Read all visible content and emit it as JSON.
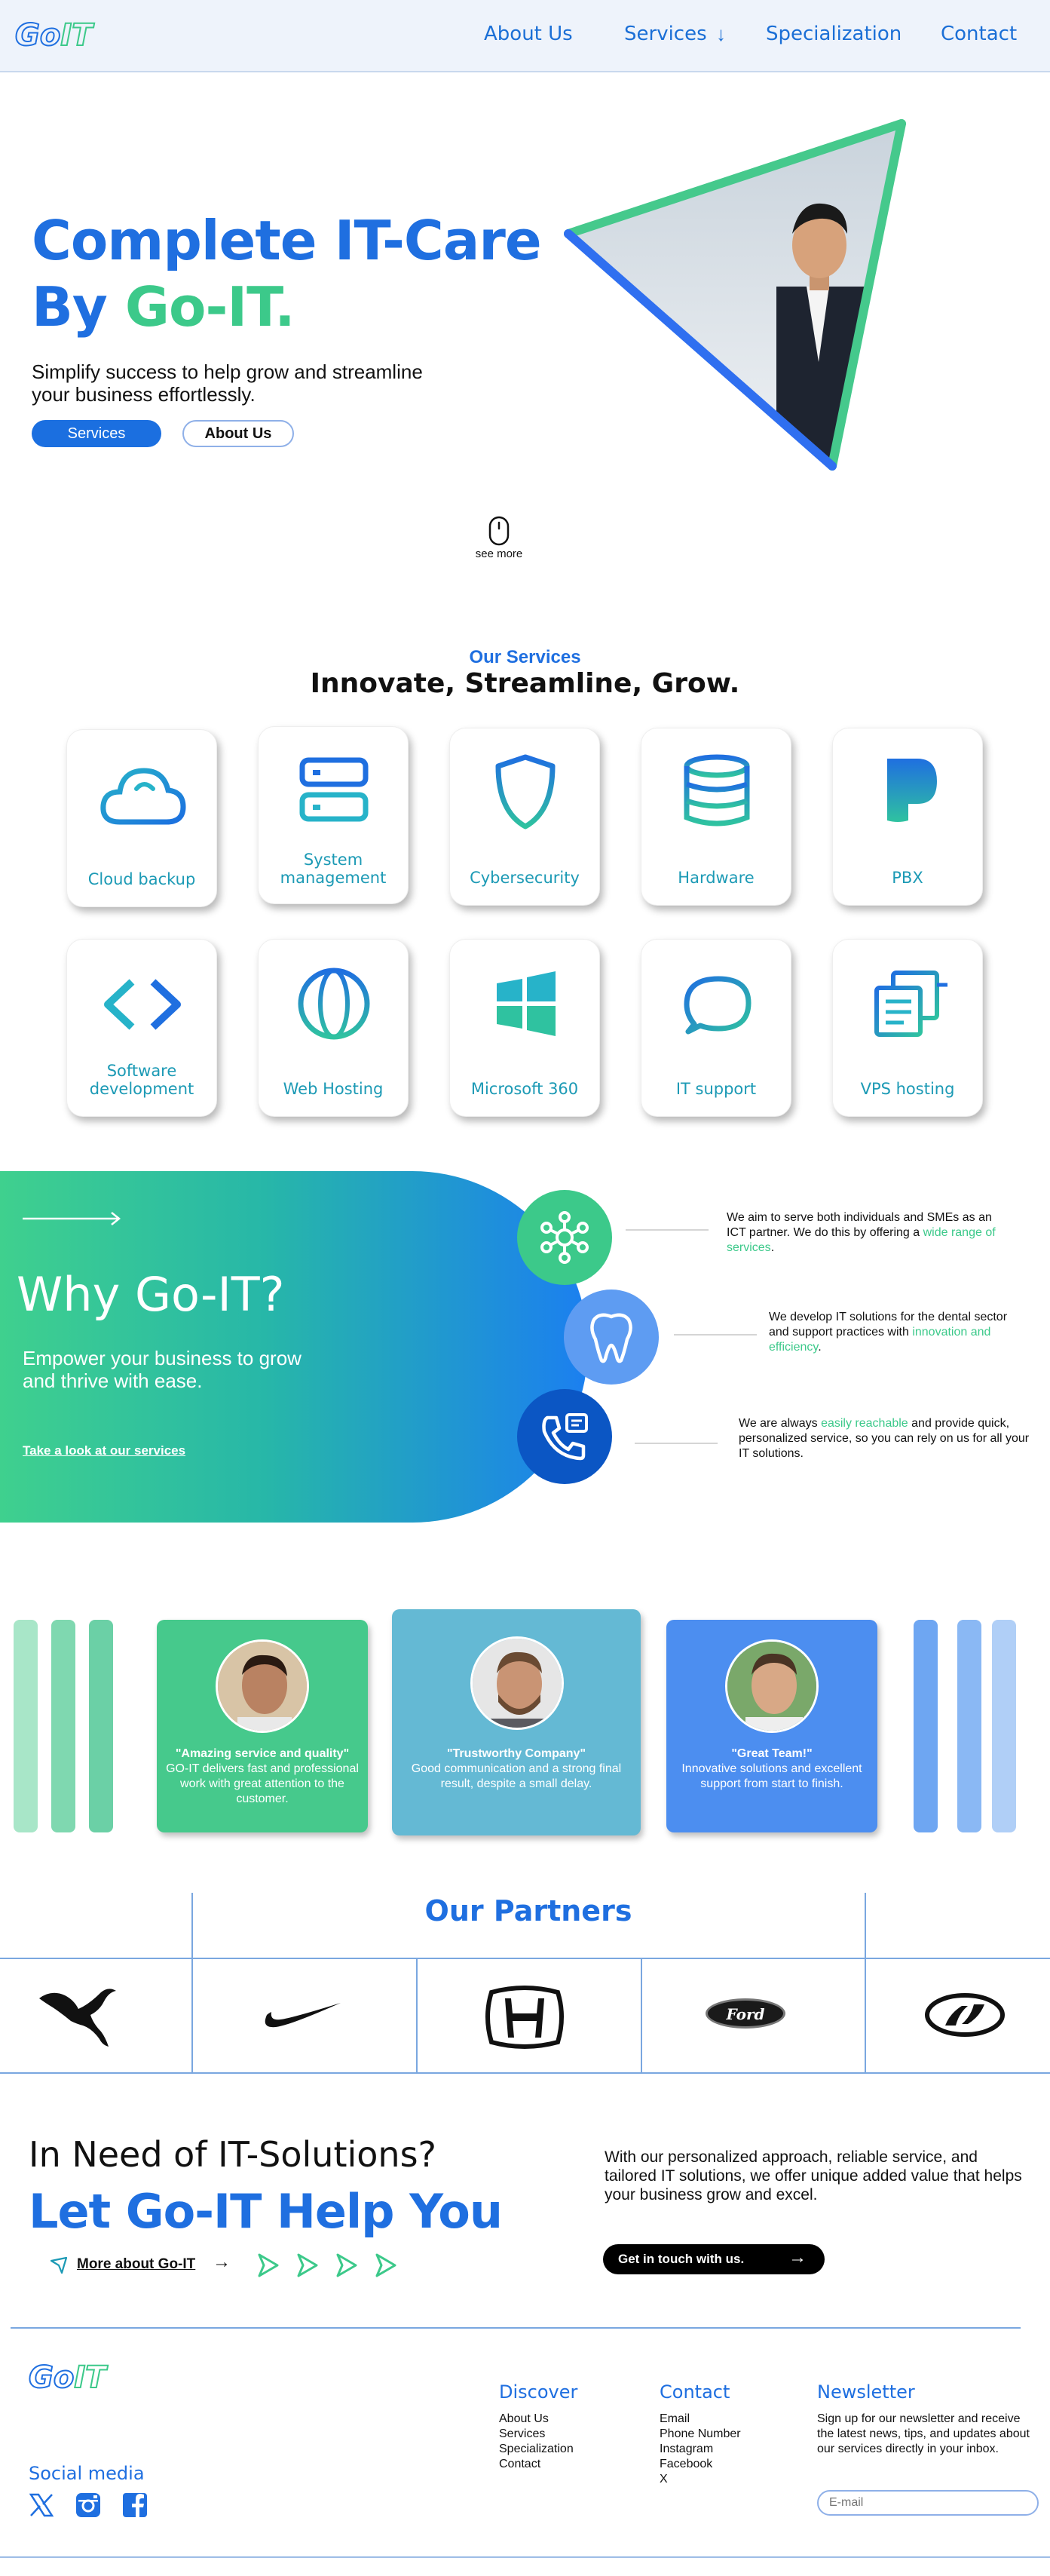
{
  "brand": {
    "logo_go": "Go",
    "logo_it": "IT"
  },
  "nav": {
    "about": "About Us",
    "services": "Services",
    "specialization": "Specialization",
    "contact": "Contact"
  },
  "hero": {
    "title_line1": "Complete IT-Care",
    "title_by": "By ",
    "title_brand": "Go-IT.",
    "subtitle": "Simplify success to help grow and streamline your business effortlessly.",
    "btn_services": "Services",
    "btn_about": "About Us",
    "see_more": "see more"
  },
  "services": {
    "kicker": "Our Services",
    "title": "Innovate, Streamline, Grow.",
    "items": [
      {
        "label": "Cloud backup",
        "icon": "cloud-icon"
      },
      {
        "label": "System management",
        "icon": "server-icon"
      },
      {
        "label": "Cybersecurity",
        "icon": "shield-icon"
      },
      {
        "label": "Hardware",
        "icon": "database-icon"
      },
      {
        "label": "PBX",
        "icon": "pbx-icon"
      },
      {
        "label": "Software development",
        "icon": "code-icon"
      },
      {
        "label": "Web Hosting",
        "icon": "globe-icon"
      },
      {
        "label": "Microsoft 360",
        "icon": "windows-icon"
      },
      {
        "label": "IT support",
        "icon": "chat-icon"
      },
      {
        "label": "VPS hosting",
        "icon": "vps-icon"
      }
    ]
  },
  "why": {
    "title": "Why Go-IT?",
    "subtitle": "Empower your business to grow and thrive with ease.",
    "link": "Take a look at our services",
    "points": [
      {
        "pre": "We aim to serve both individuals and SMEs as an ICT partner. We do this by offering a ",
        "hl": "wide range of services",
        "post": "."
      },
      {
        "pre": "We develop IT solutions for the dental sector and support practices with ",
        "hl": "innovation and efficiency",
        "post": "."
      },
      {
        "pre": "We are always ",
        "hl": "easily reachable",
        "post": " and provide quick, personalized service, so you can rely on us for all your IT solutions."
      }
    ]
  },
  "testimonials": [
    {
      "title": "\"Amazing service and quality\"",
      "text": "GO-IT delivers fast and professional work with great attention to the customer."
    },
    {
      "title": "\"Trustworthy Company\"",
      "text": "Good communication and a strong final result, despite a small delay."
    },
    {
      "title": "\"Great Team!\"",
      "text": "Innovative solutions and excellent support from start to finish."
    }
  ],
  "partners": {
    "title": "Our Partners",
    "ford_text": "Ford",
    "logos": [
      "puma-logo",
      "nike-logo",
      "honda-logo",
      "ford-logo",
      "hyundai-logo"
    ]
  },
  "cta": {
    "line1": "In Need of IT-Solutions?",
    "line2": "Let Go-IT Help You",
    "more_link": "More about Go-IT",
    "text": "With our personalized approach, reliable service, and tailored IT solutions, we offer unique added value that helps your business grow and excel.",
    "button": "Get in touch with us."
  },
  "footer": {
    "social_title": "Social media",
    "discover": {
      "title": "Discover",
      "links": [
        "About Us",
        "Services",
        "Specialization",
        "Contact"
      ]
    },
    "contact": {
      "title": "Contact",
      "links": [
        "Email",
        "Phone Number",
        "Instagram",
        "Facebook",
        "X"
      ]
    },
    "newsletter": {
      "title": "Newsletter",
      "text": "Sign up for our newsletter and receive the latest news, tips, and updates about our services directly in your inbox.",
      "placeholder": "E-mail"
    }
  },
  "colors": {
    "blue": "#1f6fe0",
    "green": "#3cc98a",
    "teal": "#1c9ab5"
  }
}
